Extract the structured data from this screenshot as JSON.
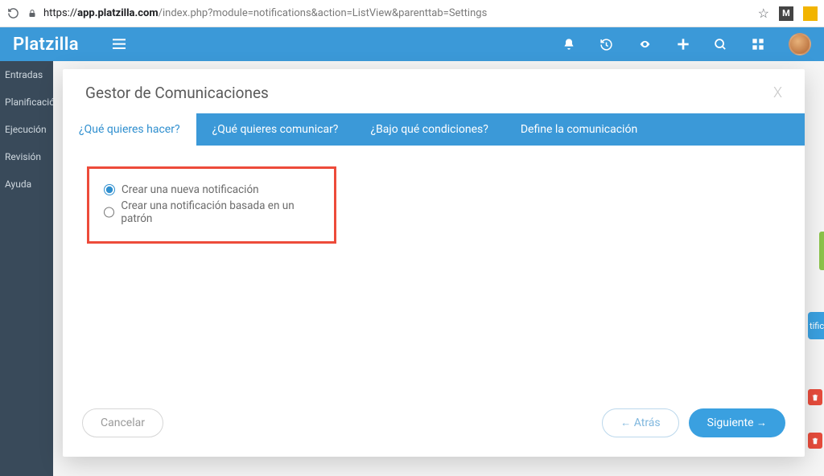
{
  "browser": {
    "url_host": "app.platzilla.com",
    "url_path": "/index.php?module=notifications&action=ListView&parenttab=Settings",
    "badge_m": "M"
  },
  "header": {
    "brand": "Platzilla"
  },
  "sidebar": {
    "items": [
      {
        "label": "Entradas"
      },
      {
        "label": "Planificación"
      },
      {
        "label": "Ejecución"
      },
      {
        "label": "Revisión"
      },
      {
        "label": "Ayuda"
      }
    ]
  },
  "bg": {
    "chip": "tifica"
  },
  "modal": {
    "title": "Gestor de Comunicaciones",
    "close": "X",
    "tabs": [
      {
        "label": "¿Qué quieres hacer?",
        "active": true
      },
      {
        "label": "¿Qué quieres comunicar?"
      },
      {
        "label": "¿Bajo qué condiciones?"
      },
      {
        "label": "Define la comunicación"
      }
    ],
    "options": [
      {
        "label": "Crear una nueva notificación",
        "selected": true
      },
      {
        "label": "Crear una notificación basada en un patrón",
        "selected": false
      }
    ],
    "buttons": {
      "cancel": "Cancelar",
      "back": "Atrás",
      "next": "Siguiente",
      "back_arrow": "←",
      "next_arrow": "→"
    }
  }
}
